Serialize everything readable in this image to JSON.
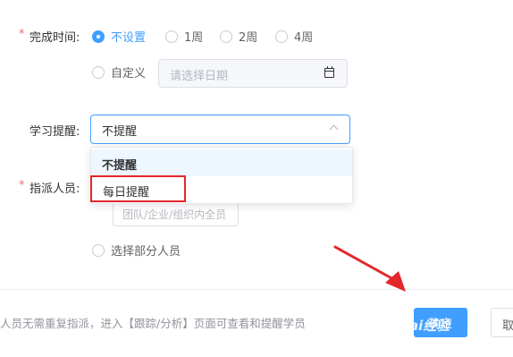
{
  "form": {
    "completion_time": {
      "required_mark": "*",
      "label": "完成时间:",
      "options": [
        "不设置",
        "1周",
        "2周",
        "4周"
      ],
      "selected": "不设置",
      "custom_label": "自定义",
      "date_placeholder": "请选择日期"
    },
    "study_reminder": {
      "label": "学习提醒:",
      "value": "不提醒",
      "dropdown_options": [
        "不提醒",
        "每日提醒"
      ]
    },
    "assignees": {
      "required_mark": "*",
      "label": "指派人员:",
      "team_button": "团队/企业/组织内全员",
      "partial_label": "选择部分人员"
    }
  },
  "footer": {
    "note": "人员无需重复指派，进入【跟踪/分析】页面可查看和提醒学员",
    "confirm_label": "确定",
    "cancel_label": "取"
  },
  "overlay": {
    "watermark": "ai经验",
    "highlight_color": "#e5262b",
    "arrow_color": "#e5262b"
  },
  "colors": {
    "primary": "#409eff",
    "required": "#f56c6c"
  }
}
